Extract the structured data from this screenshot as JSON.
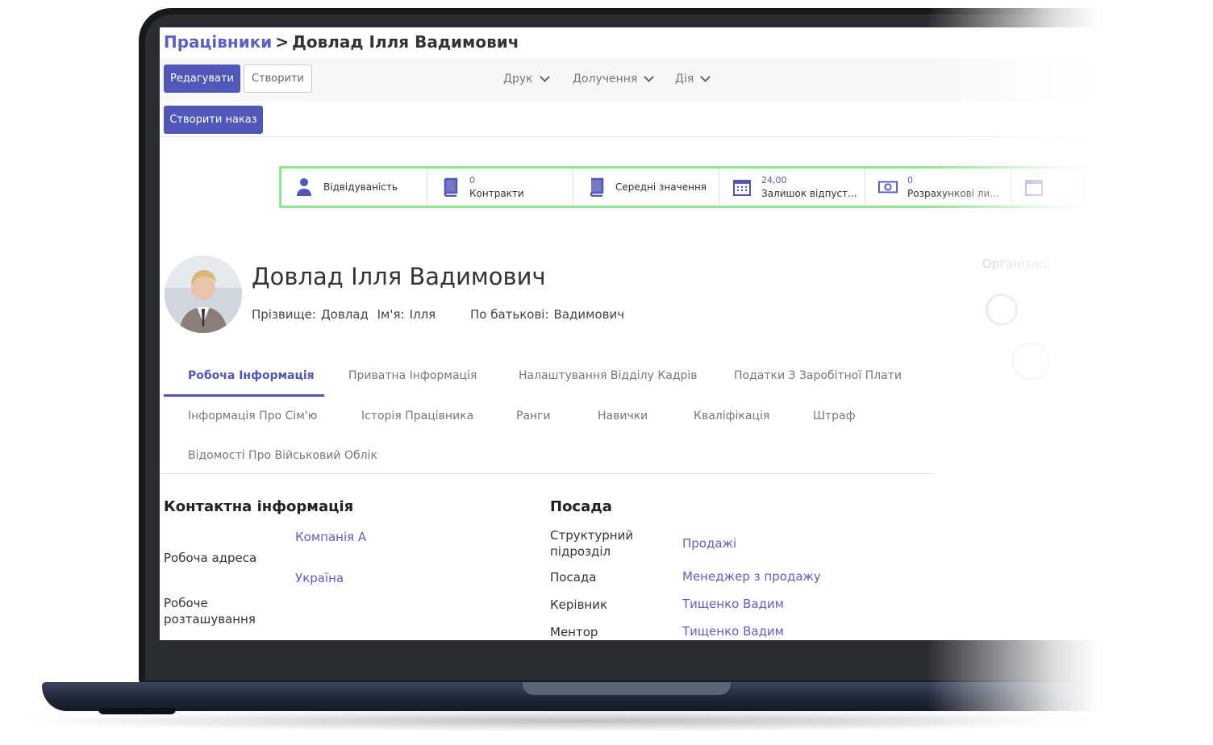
{
  "breadcrumb": {
    "parent": "Працівники",
    "separator": ">",
    "current": "Довлад Ілля Вадимович"
  },
  "toolbar": {
    "edit_label": "Редагувати",
    "create_label": "Створити",
    "print_label": "Друк",
    "attachments_label": "Долучення",
    "action_label": "Дія",
    "create_order_label": "Створити наказ"
  },
  "stats": [
    {
      "icon": "user-icon",
      "value": "",
      "label": "Відвідуваність"
    },
    {
      "icon": "book-icon",
      "value": "0",
      "label": "Контракти"
    },
    {
      "icon": "book-icon",
      "value": "",
      "label": "Середні значення"
    },
    {
      "icon": "calendar-icon",
      "value": "24,00",
      "label": "Залишок відпуст..."
    },
    {
      "icon": "money-icon",
      "value": "0",
      "label": "Розрахункові ли..."
    },
    {
      "icon": "calendar-icon",
      "value": "",
      "label": ""
    }
  ],
  "employee": {
    "name": "Довлад Ілля Вадимович",
    "surname_label": "Прізвище:",
    "surname": "Довлад",
    "firstname_label": "Ім'я:",
    "firstname": "Ілля",
    "patronymic_label": "По батькові:",
    "patronymic": "Вадимович"
  },
  "org_chart": {
    "title": "Організаці"
  },
  "tabs": [
    "Робоча Інформація",
    "Приватна Інформація",
    "Налаштування Відділу Кадрів",
    "Податки З Заробітної Плати",
    "Інформація Про Сім'ю",
    "Історія Працівника",
    "Ранги",
    "Навички",
    "Кваліфікація",
    "Штраф",
    "Відомості Про Військовий Облік"
  ],
  "contact": {
    "title": "Контактна інформація",
    "work_address_label": "Робоча адреса",
    "company": "Компанія А",
    "country": "Україна",
    "work_location_label": "Робоче розташування"
  },
  "position": {
    "title": "Посада",
    "department_label": "Структурний підрозділ",
    "department": "Продажі",
    "job_label": "Посада",
    "job": "Менеджер з продажу",
    "manager_label": "Керівник",
    "manager": "Тищенко Вадим",
    "mentor_label": "Ментор",
    "mentor": "Тищенко Вадим"
  },
  "colors": {
    "accent": "#5157b8",
    "link": "#5b5fc7",
    "highlight": "#8ee68e"
  }
}
